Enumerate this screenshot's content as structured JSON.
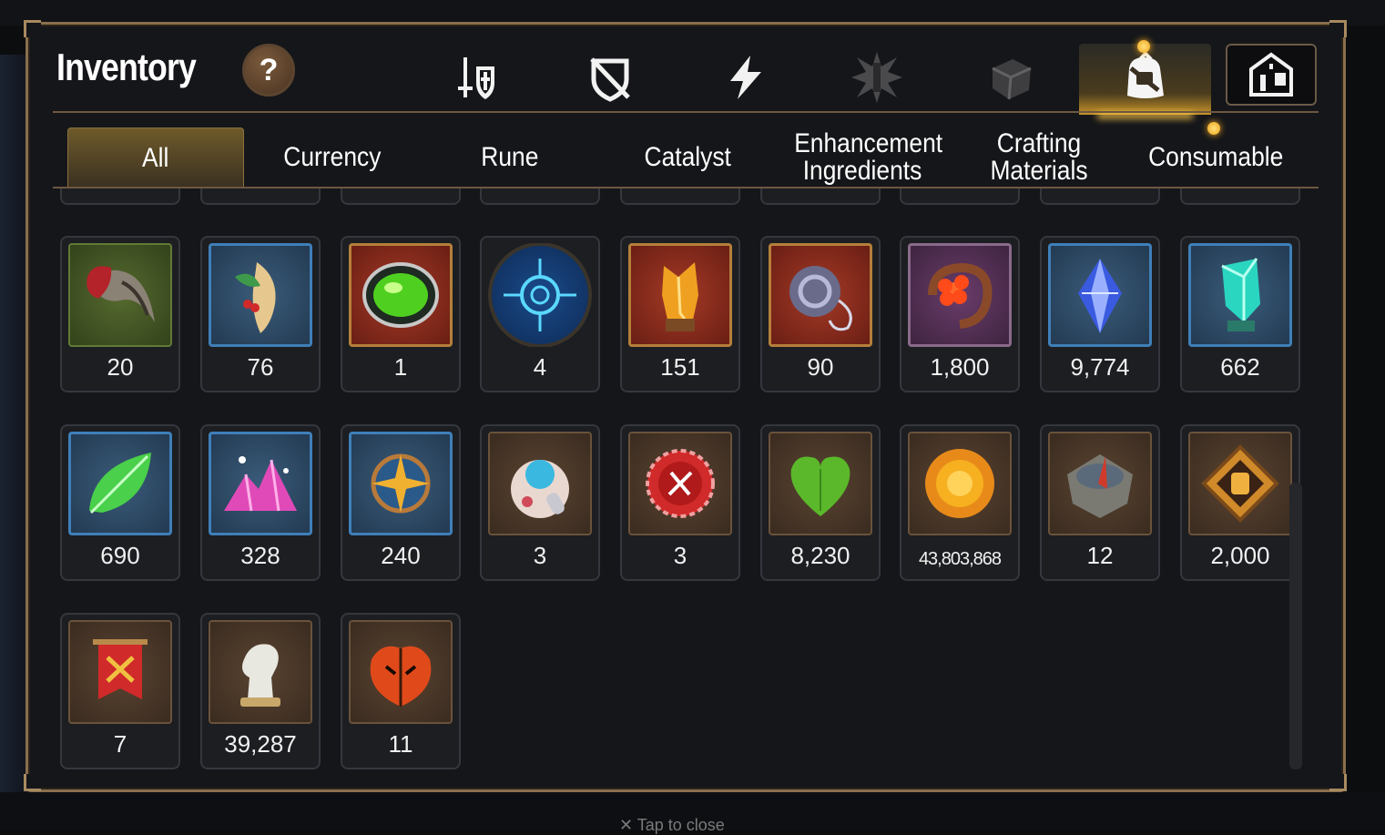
{
  "header": {
    "title": "Inventory",
    "help_symbol": "?"
  },
  "category_icons": [
    "sword-shield-icon",
    "no-shield-icon",
    "lightning-icon",
    "starburst-icon",
    "cube-icon",
    "bag-icon",
    "building-icon"
  ],
  "active_category": "bag-icon",
  "tabs": [
    "All",
    "Currency",
    "Rune",
    "Catalyst",
    "Enhancement Ingredients",
    "Crafting Materials",
    "Consumable"
  ],
  "active_tab": "All",
  "items": [
    {
      "icon": "claw-icon",
      "count": "20"
    },
    {
      "icon": "root-icon",
      "count": "76"
    },
    {
      "icon": "green-gem-icon",
      "count": "1"
    },
    {
      "icon": "rune-orb-icon",
      "count": "4"
    },
    {
      "icon": "amber-crystal-icon",
      "count": "151"
    },
    {
      "icon": "coil-icon",
      "count": "90"
    },
    {
      "icon": "flower-ring-icon",
      "count": "1,800"
    },
    {
      "icon": "blue-diamond-icon",
      "count": "9,774"
    },
    {
      "icon": "teal-crystal-icon",
      "count": "662"
    },
    {
      "icon": "leaf-icon",
      "count": "690"
    },
    {
      "icon": "pink-crystal-icon",
      "count": "328"
    },
    {
      "icon": "star-amulet-icon",
      "count": "240"
    },
    {
      "icon": "pod-icon",
      "count": "3"
    },
    {
      "icon": "badge-icon",
      "count": "3"
    },
    {
      "icon": "green-heart-icon",
      "count": "8,230"
    },
    {
      "icon": "gold-coin-icon",
      "count": "43,803,868"
    },
    {
      "icon": "stone-compass-icon",
      "count": "12"
    },
    {
      "icon": "fist-emblem-icon",
      "count": "2,000"
    },
    {
      "icon": "banner-icon",
      "count": "7"
    },
    {
      "icon": "chess-knight-icon",
      "count": "39,287"
    },
    {
      "icon": "red-leaf-icon",
      "count": "11"
    }
  ],
  "footer": {
    "close_hint": "✕ Tap to close"
  },
  "colors": {
    "frame_gold": "#8a6f4d",
    "tab_active": "#6e5a2a",
    "notify": "#f0a21b"
  }
}
